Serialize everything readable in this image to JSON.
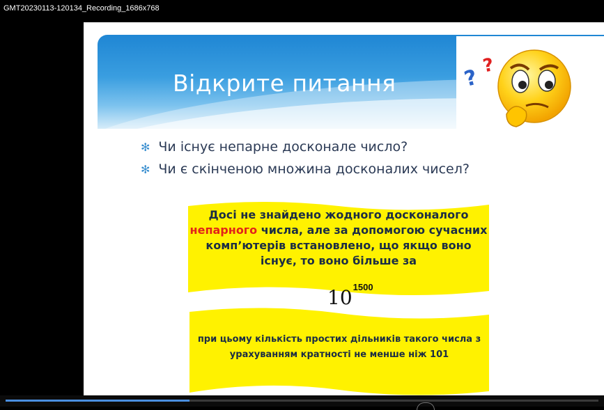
{
  "window": {
    "title": "GMT20230113-120134_Recording_1686x768"
  },
  "slide": {
    "title": "Відкрите питання",
    "bullets": [
      "Чи існує непарне досконале число?",
      "Чи є скінченою множина досконалих чисел?"
    ],
    "box1": {
      "part1": "Досі не знайдено жодного досконалого",
      "highlight": "непарного",
      "part2": " числа, але за допомогою сучасних комп’ютерів встановлено, що якщо воно існує, то воно більше за"
    },
    "formula": {
      "base": "10",
      "exponent": "1500"
    },
    "box2": {
      "text": "при цьому кількість простих дільників такого числа з урахуванням кратності не менше ніж 101"
    }
  },
  "player": {
    "progress": 0.31
  },
  "colors": {
    "banner": "#2a8fd8",
    "highlight": "#fff200",
    "accent_red": "#e2231a",
    "text": "#1b2d44"
  },
  "icons": {
    "thinking-emoji": "thinking-face-with-question-marks",
    "bullet": "asterisk"
  }
}
